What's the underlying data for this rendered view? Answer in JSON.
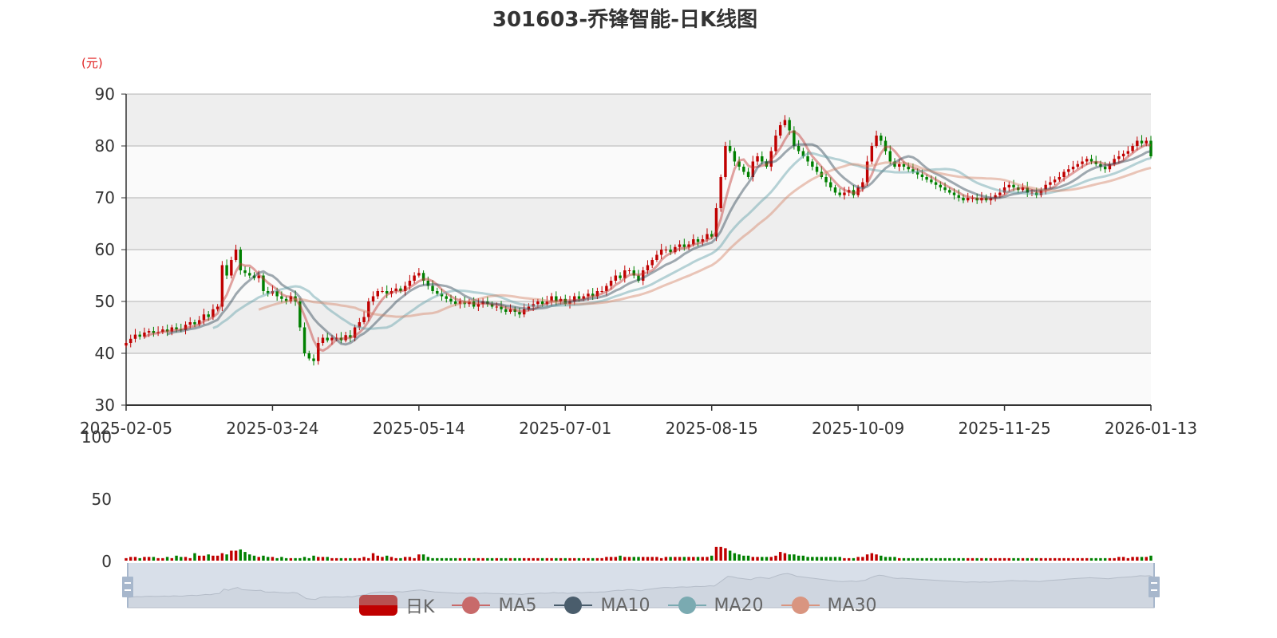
{
  "chart_data": {
    "type": "candlestick",
    "title": "301603-乔锋智能-日K线图",
    "ylabel": "(元)",
    "ylim": [
      30,
      90
    ],
    "yticks": [
      "30",
      "40",
      "50",
      "60",
      "70",
      "80",
      "90"
    ],
    "volume_ylim": [
      0,
      100
    ],
    "volume_yticks": [
      "0",
      "50",
      "100"
    ],
    "xtick_labels": [
      "2025-02-05",
      "2025-03-24",
      "2025-05-14",
      "2025-07-01",
      "2025-08-15",
      "2025-10-09",
      "2025-11-25",
      "2026-01-13"
    ],
    "xtick_every": 32,
    "colors": {
      "up": "#c00000",
      "down": "#008000",
      "ma5": "#c23531",
      "ma10": "#2f4554",
      "ma20": "#61a0a8",
      "ma30": "#d48265"
    },
    "legend": [
      "日K",
      "MA5",
      "MA10",
      "MA20",
      "MA30"
    ],
    "first_open": 41.5,
    "close": [
      42,
      42.8,
      43.6,
      43.2,
      44,
      44.3,
      43.9,
      44.1,
      44.6,
      44.2,
      45,
      44.6,
      44.5,
      45.5,
      46,
      45.6,
      46.4,
      47.5,
      47,
      48.5,
      49,
      57,
      55,
      58,
      60,
      56,
      55.5,
      55,
      54.5,
      55,
      52,
      51.5,
      52,
      51,
      50.5,
      50,
      51,
      50,
      45,
      40,
      39,
      38.5,
      42,
      43,
      42.5,
      43,
      43,
      42.5,
      43.5,
      43,
      45,
      46,
      47,
      50,
      51,
      52,
      52,
      51.5,
      52,
      52.5,
      52,
      53,
      54,
      55,
      55.5,
      54,
      53,
      52,
      51.5,
      51,
      50.5,
      50,
      49.5,
      50,
      49.5,
      50,
      49,
      49.5,
      50,
      49.5,
      49,
      49,
      48.5,
      48,
      48.5,
      48,
      47.5,
      48.5,
      49,
      49.5,
      50,
      49.5,
      50,
      51,
      50,
      50.5,
      49.5,
      50,
      51,
      50.5,
      51,
      51.5,
      51,
      52,
      52,
      53,
      54,
      55,
      54.5,
      56,
      56,
      55,
      54,
      56,
      57,
      58,
      59,
      60,
      60,
      59.5,
      60.5,
      61,
      60.5,
      61,
      62,
      61.5,
      62,
      63,
      62.5,
      68,
      74,
      80,
      79,
      77,
      76,
      75,
      74,
      77,
      78,
      77,
      76,
      79,
      82,
      84,
      85,
      83,
      80,
      79,
      78,
      77,
      76,
      75,
      74,
      73,
      72,
      71,
      70.5,
      71,
      71.5,
      70.5,
      72,
      73,
      77,
      80,
      82,
      81,
      79,
      77,
      76,
      76.5,
      76,
      75.5,
      75,
      74.5,
      74,
      73.5,
      73,
      72.5,
      72,
      71.5,
      71,
      70.5,
      70,
      69.5,
      70,
      70,
      69.5,
      70,
      69.5,
      70,
      70.5,
      71,
      72,
      72.5,
      72,
      71.5,
      72,
      71,
      71,
      70.5,
      71.5,
      72.5,
      73,
      73.5,
      74,
      75,
      75.5,
      76,
      76.5,
      77,
      77.5,
      77,
      76.5,
      76,
      75.5,
      76.5,
      77.5,
      78,
      78.5,
      79,
      80,
      81,
      80.5,
      81,
      78
    ],
    "volume": [
      2,
      3,
      3,
      2,
      3,
      3,
      3,
      2,
      2,
      3,
      2,
      4,
      3,
      3,
      2,
      6,
      4,
      4,
      5,
      4,
      4,
      6,
      5,
      8,
      8,
      9,
      7,
      5,
      4,
      3,
      4,
      3,
      3,
      2,
      3,
      2,
      2,
      2,
      2,
      3,
      2,
      4,
      3,
      3,
      3,
      2,
      2,
      2,
      2,
      2,
      2,
      2,
      3,
      2,
      6,
      4,
      3,
      4,
      3,
      2,
      2,
      3,
      3,
      2,
      5,
      5,
      3,
      2,
      2,
      2,
      2,
      2,
      2,
      2,
      2,
      2,
      2,
      2,
      2,
      2,
      2,
      2,
      2,
      2,
      2,
      2,
      2,
      2,
      2,
      2,
      2,
      2,
      2,
      2,
      2,
      2,
      2,
      2,
      2,
      2,
      2,
      2,
      2,
      2,
      2,
      3,
      3,
      3,
      4,
      3,
      3,
      3,
      3,
      3,
      3,
      3,
      3,
      2,
      3,
      3,
      3,
      3,
      3,
      3,
      3,
      3,
      3,
      3,
      4,
      11,
      11,
      10,
      8,
      6,
      5,
      4,
      4,
      3,
      3,
      3,
      3,
      3,
      4,
      7,
      6,
      5,
      5,
      4,
      4,
      3,
      3,
      3,
      3,
      3,
      3,
      3,
      3,
      2,
      2,
      2,
      3,
      3,
      5,
      6,
      5,
      4,
      3,
      3,
      3,
      2,
      2,
      2,
      2,
      2,
      2,
      2,
      2,
      2,
      2,
      2,
      2,
      2,
      2,
      2,
      2,
      2,
      2,
      2,
      2,
      2,
      2,
      2,
      2,
      2,
      2,
      2,
      2,
      2,
      2,
      2,
      2,
      2,
      2,
      2,
      2,
      2,
      2,
      2,
      2,
      2,
      2,
      2,
      2,
      2,
      2,
      2,
      2,
      3,
      3,
      2,
      3,
      3,
      3,
      3,
      4
    ]
  }
}
